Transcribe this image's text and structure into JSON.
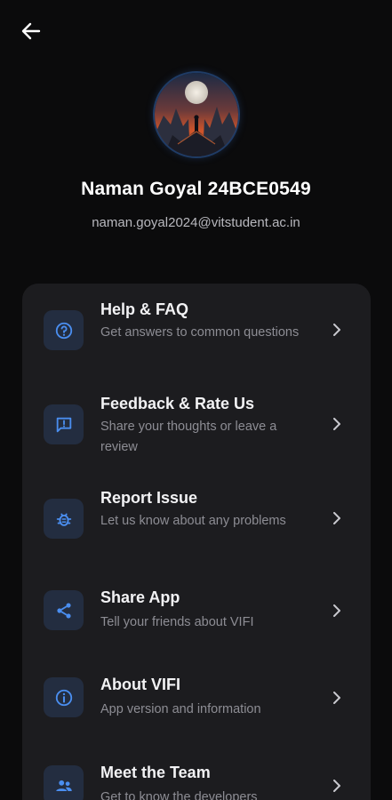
{
  "header": {
    "back_icon": "arrow-left-icon"
  },
  "profile": {
    "name": "Naman Goyal 24BCE0549",
    "email": "naman.goyal2024@vitstudent.ac.in"
  },
  "colors": {
    "background": "#0b0b0c",
    "card": "#1c1c1f",
    "icon_tile": "#232d40",
    "accent": "#4a8ef0",
    "subtitle": "#8d8d94"
  },
  "menu": {
    "items": [
      {
        "icon": "help-circle-icon",
        "title": "Help & FAQ",
        "subtitle": "Get answers to common questions"
      },
      {
        "icon": "feedback-icon",
        "title": "Feedback & Rate Us",
        "subtitle": "Share your thoughts or leave a review"
      },
      {
        "icon": "bug-icon",
        "title": "Report Issue",
        "subtitle": "Let us know about any problems"
      },
      {
        "icon": "share-icon",
        "title": "Share App",
        "subtitle": "Tell your friends about VIFI"
      },
      {
        "icon": "info-icon",
        "title": "About VIFI",
        "subtitle": "App version and information"
      },
      {
        "icon": "people-icon",
        "title": "Meet the Team",
        "subtitle": "Get to know the developers"
      }
    ]
  }
}
